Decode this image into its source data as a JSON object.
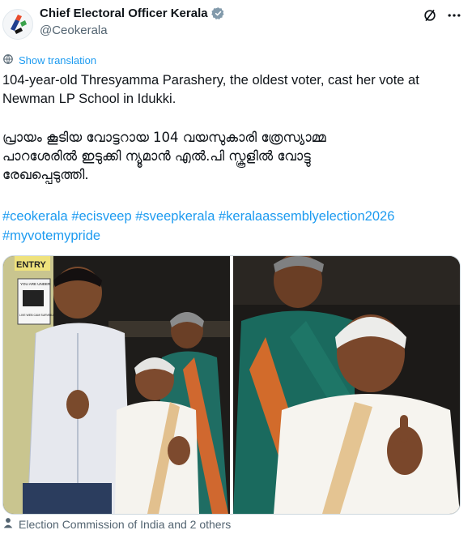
{
  "author": {
    "name": "Chief Electoral Officer Kerala",
    "handle": "@Ceokerala"
  },
  "translate_label": "Show translation",
  "post": {
    "english": "104-year-old Thresyamma Parashery, the oldest voter, cast her vote at Newman LP School in Idukki.",
    "malayalam_line1": "പ്രായം കൂടിയ വോട്ടറായ 104 വയസുകാരി ത്രേസ്യാമ്മ",
    "malayalam_line2": "പാറശേരിൽ ഇടുക്കി ന്യൂമാൻ എൽ.പി സ്കൂളിൽ വോട്ടു",
    "malayalam_line3": "രേഖപ്പെടുത്തി.",
    "hashtags": [
      "#ceokerala",
      "#ecisveep",
      "#sveepkerala",
      "#keralaassemblyelection2026",
      "#myvotemypride"
    ]
  },
  "media": {
    "sign_entry": "ENTRY",
    "sign_small": "YOU ARE UNDER",
    "sign_small2": "LIVE WEB CAM SURVEILLANCE"
  },
  "tagged": "Election Commission of India and 2 others",
  "colors": {
    "accent": "#1d9bf0",
    "muted": "#536471",
    "text": "#0f1419"
  }
}
